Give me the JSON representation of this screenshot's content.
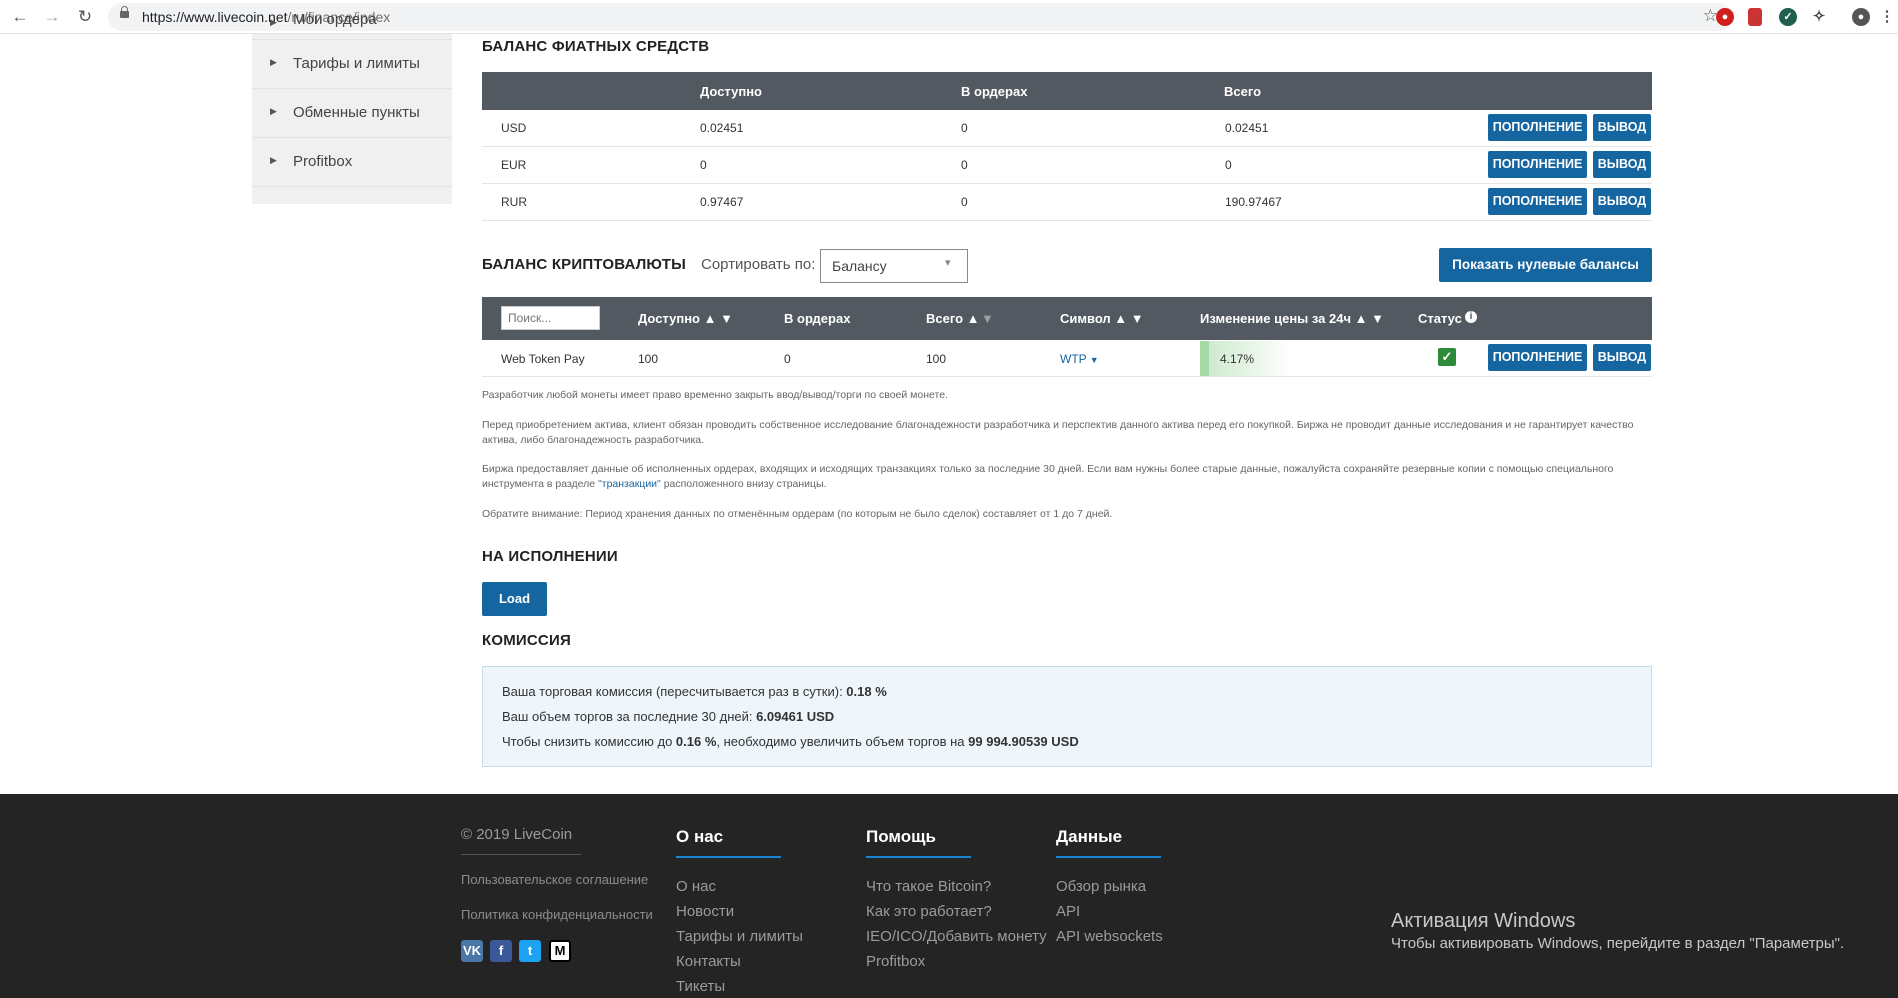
{
  "browser": {
    "url_host": "https://www.livecoin.net",
    "url_path": "/ru/finance/index"
  },
  "sidebar": {
    "items": [
      {
        "label": "Мои ордера"
      },
      {
        "label": "Тарифы и лимиты"
      },
      {
        "label": "Обменные пункты"
      },
      {
        "label": "Profitbox"
      }
    ]
  },
  "fiat": {
    "title": "БАЛАНС ФИАТНЫХ СРЕДСТВ",
    "headers": {
      "available": "Доступно",
      "in_orders": "В ордерах",
      "total": "Всего"
    },
    "rows": [
      {
        "currency": "USD",
        "available": "0.02451",
        "in_orders": "0",
        "total": "0.02451"
      },
      {
        "currency": "EUR",
        "available": "0",
        "in_orders": "0",
        "total": "0"
      },
      {
        "currency": "RUR",
        "available": "0.97467",
        "in_orders": "0",
        "total": "190.97467"
      }
    ],
    "deposit_label": "ПОПОЛНЕНИЕ",
    "withdraw_label": "ВЫВОД"
  },
  "crypto": {
    "title": "БАЛАНС КРИПТОВАЛЮТЫ",
    "sort_label": "Сортировать по:",
    "sort_value": "Балансу",
    "show_zero_label": "Показать нулевые балансы",
    "search_placeholder": "Поиск...",
    "headers": {
      "available": "Доступно ▲ ▼",
      "in_orders": "В ордерах",
      "total": "Всего ▲",
      "total_down": "▼",
      "symbol": "Символ ▲ ▼",
      "change": "Изменение цены за 24ч ▲ ▼",
      "status": "Статус"
    },
    "rows": [
      {
        "name": "Web Token Pay",
        "available": "100",
        "in_orders": "0",
        "total": "100",
        "symbol": "WTP",
        "change": "4.17%",
        "status_ok": true
      }
    ],
    "deposit_label": "ПОПОЛНЕНИЕ",
    "withdraw_label": "ВЫВОД"
  },
  "notes": {
    "n1": "Разработчик любой монеты имеет право временно закрыть ввод/вывод/торги по своей монете.",
    "n2": "Перед приобретением актива, клиент обязан проводить собственное исследование благонадежности разработчика и перспектив данного актива перед его покупкой. Биржа не проводит данные исследования и не гарантирует качество актива, либо благонадежность разработчика.",
    "n3_pre": "Биржа предоставляет данные об исполненных ордерах, входящих и исходящих транзакциях только за последние 30 дней. Если вам нужны более старые данные, пожалуйста сохраняйте резервные копии с помощью специального инструмента в разделе \"",
    "n3_link": "транзакции",
    "n3_post": "\" расположенного внизу страницы.",
    "n4": "Обратите внимание: Период хранения данных по отменённым ордерам (по которым не было сделок) составляет от 1 до 7 дней."
  },
  "executing": {
    "title": "НА ИСПОЛНЕНИИ",
    "load_label": "Load"
  },
  "commission": {
    "title": "КОМИССИЯ",
    "line1_pre": "Ваша торговая комиссия (пересчитывается раз в сутки): ",
    "line1_val": "0.18 %",
    "line2_pre": "Ваш объем торгов за последние 30 дней: ",
    "line2_val": "6.09461 USD",
    "line3_pre": "Чтобы снизить комиссию до ",
    "line3_val1": "0.16 %",
    "line3_mid": ", необходимо увеличить объем торгов на ",
    "line3_val2": "99 994.90539 USD"
  },
  "footer": {
    "copyright": "© 2019 LiveCoin",
    "agreement": "Пользовательское соглашение",
    "privacy": "Политика конфиденциальности",
    "cols": [
      {
        "title": "О нас",
        "links": [
          "О нас",
          "Новости",
          "Тарифы и лимиты",
          "Контакты",
          "Тикеты"
        ]
      },
      {
        "title": "Помощь",
        "links": [
          "Что такое Bitcoin?",
          "Как это работает?",
          "IEO/ICO/Добавить монету",
          "Profitbox"
        ]
      },
      {
        "title": "Данные",
        "links": [
          "Обзор рынка",
          "API",
          "API websockets"
        ]
      }
    ],
    "social": {
      "vk": "VK",
      "fb": "f",
      "tw": "t",
      "medium": "M"
    }
  },
  "windows": {
    "title": "Активация Windows",
    "text": "Чтобы активировать Windows, перейдите в раздел \"Параметры\"."
  },
  "colors": {
    "accent": "#1565a0",
    "header": "#525960",
    "footer": "#242424",
    "ok": "#2e8b3a"
  }
}
